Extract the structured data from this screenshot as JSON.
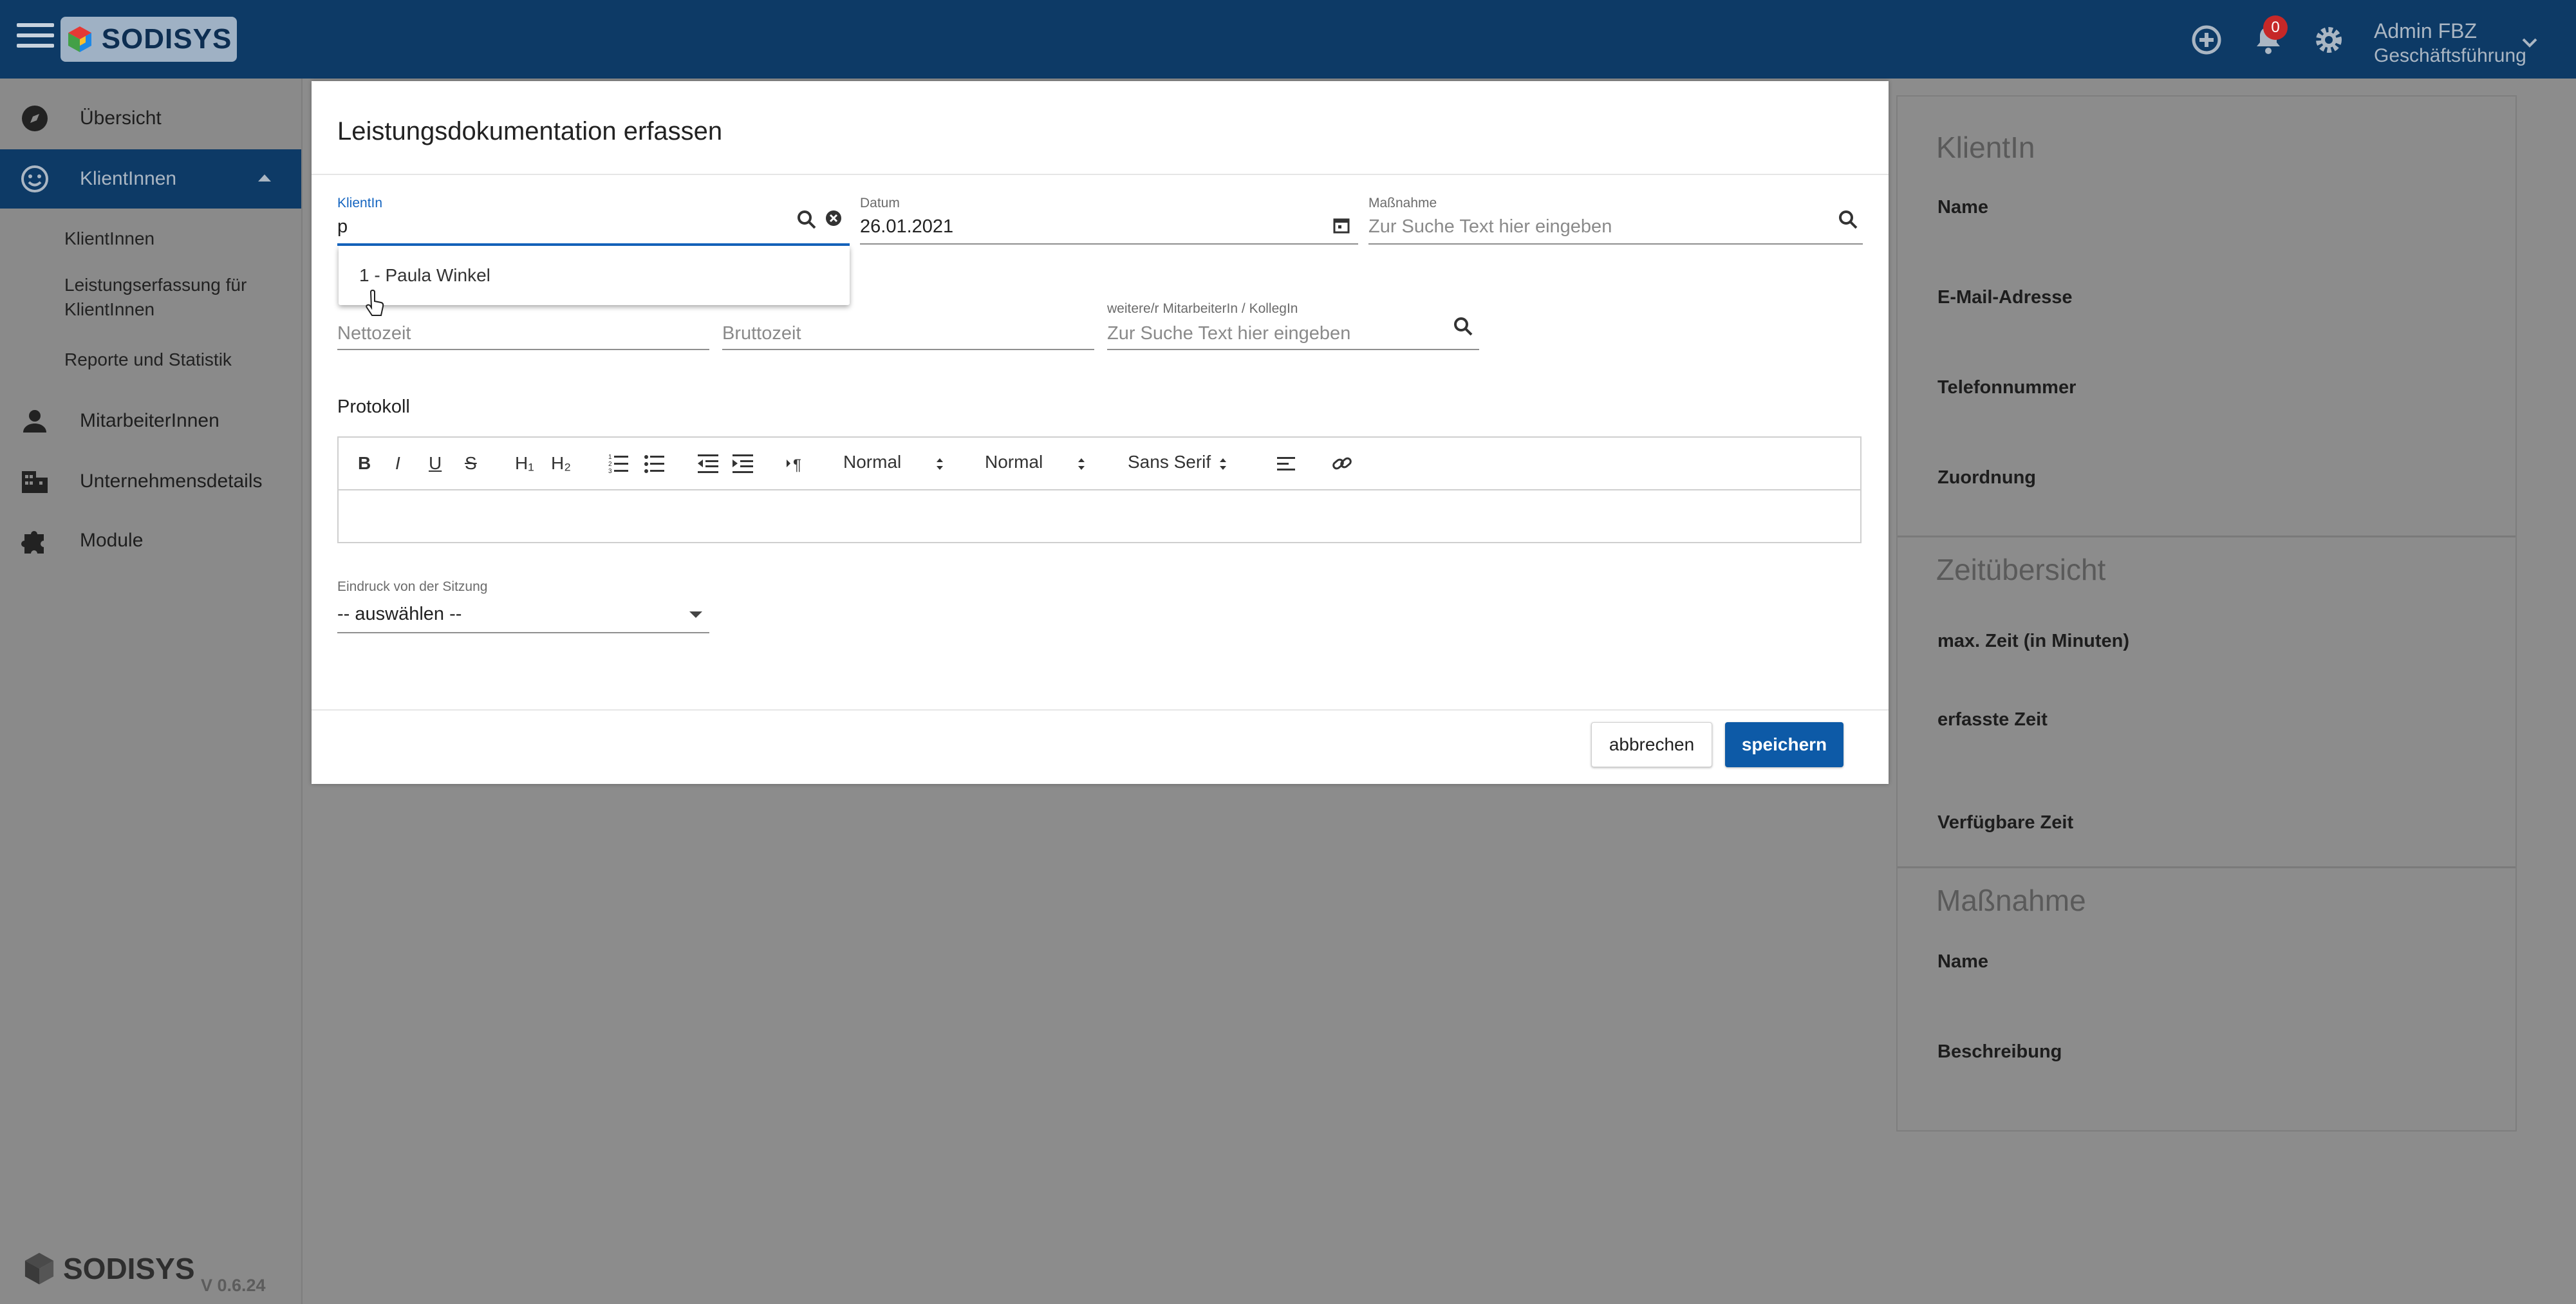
{
  "header": {
    "brand": "SODISYS",
    "notifications_count": "0",
    "user_name": "Admin FBZ",
    "user_role": "Geschäftsführung"
  },
  "sidebar": {
    "items": [
      {
        "label": "Übersicht",
        "icon": "compass-icon"
      },
      {
        "label": "KlientInnen",
        "icon": "smiley-icon"
      },
      {
        "label": "MitarbeiterInnen",
        "icon": "person-icon"
      },
      {
        "label": "Unternehmensdetails",
        "icon": "building-icon"
      },
      {
        "label": "Module",
        "icon": "puzzle-icon"
      }
    ],
    "subitems": [
      {
        "label": "KlientInnen"
      },
      {
        "label_line1": "Leistungserfassung für",
        "label_line2": "KlientInnen"
      },
      {
        "label": "Reporte und Statistik"
      }
    ],
    "footer_brand": "SODISYS",
    "version": "V 0.6.24"
  },
  "right_panel": {
    "section1": "KlientIn",
    "labels1": [
      "Name",
      "E-Mail-Adresse",
      "Telefonnummer",
      "Zuordnung"
    ],
    "section2": "Zeitübersicht",
    "labels2": [
      "max. Zeit (in Minuten)",
      "erfasste Zeit",
      "Verfügbare Zeit"
    ],
    "section3": "Maßnahme",
    "labels3": [
      "Name",
      "Beschreibung"
    ]
  },
  "modal": {
    "title": "Leistungsdokumentation erfassen",
    "client": {
      "label": "KlientIn",
      "value": "p"
    },
    "dropdown_option": "1 - Paula Winkel",
    "date": {
      "label": "Datum",
      "value": "26.01.2021"
    },
    "measure": {
      "label": "Maßnahme",
      "placeholder": "Zur Suche Text hier eingeben"
    },
    "net_time": {
      "placeholder": "Nettozeit"
    },
    "gross_time": {
      "placeholder": "Bruttozeit"
    },
    "colleague": {
      "label": "weitere/r MitarbeiterIn / KollegIn",
      "placeholder": "Zur Suche Text hier eingeben"
    },
    "protocol_label": "Protokoll",
    "toolbar": {
      "bold": "B",
      "italic": "I",
      "underline": "U",
      "strike": "S",
      "h1": "H₁",
      "h2": "H₂",
      "size_select": "Normal",
      "header_select": "Normal",
      "font_select": "Sans Serif"
    },
    "impression": {
      "label": "Eindruck von der Sitzung",
      "value": "-- auswählen --"
    },
    "cancel_label": "abbrechen",
    "save_label": "speichern"
  },
  "colors": {
    "topbar": "#0d3a66",
    "accent": "#0d5aa7",
    "badge": "#c62828"
  }
}
